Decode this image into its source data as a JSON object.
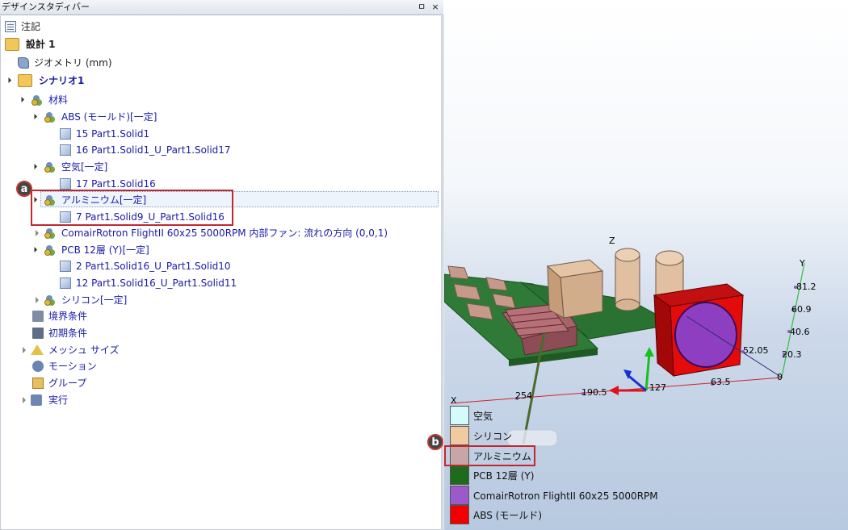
{
  "panel": {
    "title": "デザインスタディバー",
    "pin_glyph": "ㅁ",
    "close_glyph": "×"
  },
  "tree": {
    "notes": "注記",
    "design": "設計 1",
    "geometry": "ジオメトリ (mm)",
    "scenario": "シナリオ1",
    "materials": "材料",
    "abs": "ABS (モールド)[一定]",
    "abs_part1": "15 Part1.Solid1",
    "abs_part2": "16 Part1.Solid1_U_Part1.Solid17",
    "air": "空気[一定]",
    "air_part": "17 Part1.Solid16",
    "aluminum": "アルミニウム[一定]",
    "aluminum_part": "7 Part1.Solid9_U_Part1.Solid16",
    "fan": "ComairRotron FlightII 60x25 5000RPM 内部ファン: 流れの方向 (0,0,1)",
    "pcb": "PCB 12層 (Y)[一定]",
    "pcb_part1": "2 Part1.Solid16_U_Part1.Solid10",
    "pcb_part2": "12 Part1.Solid16_U_Part1.Solid11",
    "silicon": "シリコン[一定]",
    "boundary": "境界条件",
    "initial": "初期条件",
    "mesh": "メッシュ サイズ",
    "motion": "モーション",
    "group": "グループ",
    "run": "実行"
  },
  "callouts": {
    "a": "a",
    "b": "b"
  },
  "axis": {
    "x_label": "X",
    "y_label": "Y",
    "z_label": "Z",
    "x_ticks": [
      "254",
      "190.5",
      "127",
      "63.5",
      "0"
    ],
    "y_ticks": [
      "81.2",
      "60.9",
      "40.6",
      "20.3"
    ],
    "z_tick": "52.05"
  },
  "legend": [
    {
      "label": "空気",
      "color": "#d4fbfb"
    },
    {
      "label": "シリコン",
      "color": "#f0caa0"
    },
    {
      "label": "アルミニウム",
      "color": "#c9a6a6"
    },
    {
      "label": "PCB 12層 (Y)",
      "color": "#1e6b1e"
    },
    {
      "label": "ComairRotron FlightII 60x25 5000RPM",
      "color": "#9b59c9"
    },
    {
      "label": "ABS (モールド)",
      "color": "#f20000"
    }
  ],
  "colors": {
    "callout_red": "#c0282e",
    "tree_blue": "#1a1aa8"
  }
}
